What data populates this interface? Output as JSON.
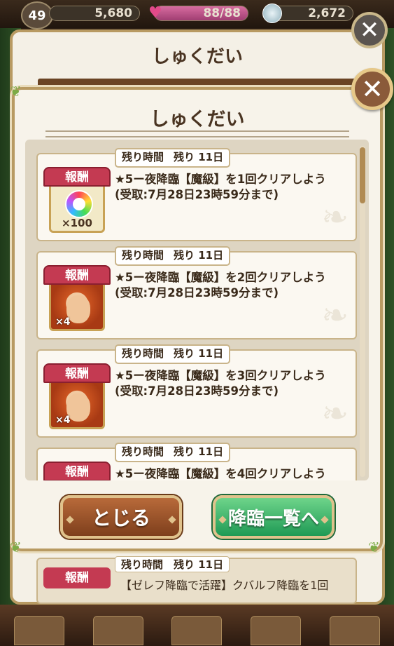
{
  "hud": {
    "level": "49",
    "stat1": "5,680",
    "stamina": "88/88",
    "gems": "2,672"
  },
  "back_dialog": {
    "title": "しゅくだい",
    "item": {
      "reward_label": "報酬",
      "time": "残り時間　残り 11日",
      "text": "【ゼレフ降臨で活躍】クバルフ降臨を1回"
    }
  },
  "dialog": {
    "title": "しゅくだい",
    "close_label": "✕",
    "missions": [
      {
        "time_label": "残り時間",
        "time_value": "残り 11日",
        "reward_label": "報酬",
        "reward_type": "orb",
        "reward_count": "×100",
        "text": "★5ー夜降臨【魔級】を1回クリアしよう",
        "deadline": "(受取:7月28日23時59分まで)"
      },
      {
        "time_label": "残り時間",
        "time_value": "残り 11日",
        "reward_label": "報酬",
        "reward_type": "character",
        "reward_count": "×4",
        "text": "★5ー夜降臨【魔級】を2回クリアしよう",
        "deadline": "(受取:7月28日23時59分まで)"
      },
      {
        "time_label": "残り時間",
        "time_value": "残り 11日",
        "reward_label": "報酬",
        "reward_type": "character",
        "reward_count": "×4",
        "text": "★5ー夜降臨【魔級】を3回クリアしよう",
        "deadline": "(受取:7月28日23時59分まで)"
      },
      {
        "time_label": "残り時間",
        "time_value": "残り 11日",
        "reward_label": "報酬",
        "reward_type": "character",
        "reward_count": "",
        "text": "★5ー夜降臨【魔級】を4回クリアしよう",
        "deadline": ""
      }
    ],
    "buttons": {
      "close": "とじる",
      "go": "降臨一覧へ"
    }
  },
  "colors": {
    "reward_red": "#c43a52",
    "frame_gold": "#b89a62",
    "close_btn": "#7e3f1c",
    "go_btn": "#1f9a55"
  }
}
